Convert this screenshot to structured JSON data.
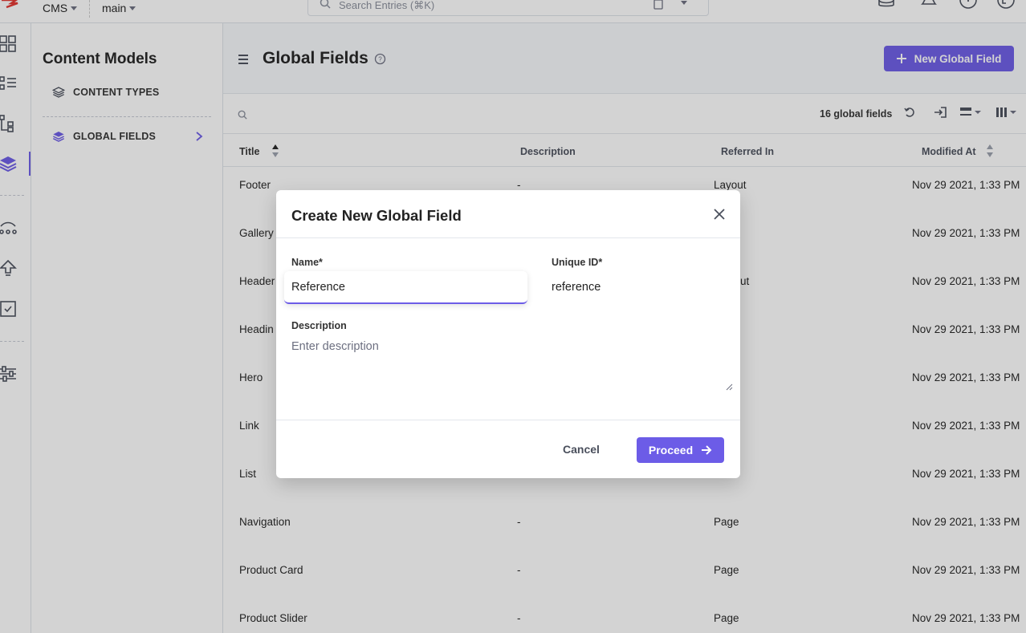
{
  "topbar": {
    "stack": "CMS",
    "branch": "main",
    "search_placeholder": "Search Entries (⌘K)"
  },
  "sidebar": {
    "title": "Content Models",
    "items": [
      {
        "label": "CONTENT TYPES"
      },
      {
        "label": "GLOBAL FIELDS"
      }
    ]
  },
  "main": {
    "title": "Global Fields",
    "new_button": "New Global Field",
    "count_label": "16 global fields",
    "columns": [
      "Title",
      "Description",
      "Referred In",
      "Modified At"
    ],
    "rows": [
      {
        "title": "Footer",
        "description": "-",
        "referred_in": "Layout",
        "modified": "Nov 29 2021, 1:33 PM"
      },
      {
        "title": "Gallery",
        "description": "",
        "referred_in": "",
        "modified": "Nov 29 2021, 1:33 PM"
      },
      {
        "title": "Header",
        "description": "",
        "referred_in": "ut",
        "modified": "Nov 29 2021, 1:33 PM"
      },
      {
        "title": "Headin",
        "description": "",
        "referred_in": "",
        "modified": "Nov 29 2021, 1:33 PM"
      },
      {
        "title": "Hero",
        "description": "",
        "referred_in": "",
        "modified": "Nov 29 2021, 1:33 PM"
      },
      {
        "title": "Link",
        "description": "",
        "referred_in": "",
        "modified": "Nov 29 2021, 1:33 PM"
      },
      {
        "title": "List",
        "description": "",
        "referred_in": "",
        "modified": "Nov 29 2021, 1:33 PM"
      },
      {
        "title": "Navigation",
        "description": "-",
        "referred_in": "Page",
        "modified": "Nov 29 2021, 1:33 PM"
      },
      {
        "title": "Product Card",
        "description": "-",
        "referred_in": "Page",
        "modified": "Nov 29 2021, 1:33 PM"
      },
      {
        "title": "Product Slider",
        "description": "-",
        "referred_in": "Page",
        "modified": "Nov 29 2021, 1:33 PM"
      }
    ]
  },
  "modal": {
    "title": "Create New Global Field",
    "name_label": "Name*",
    "name_value": "Reference",
    "uid_label": "Unique ID*",
    "uid_value": "reference",
    "description_label": "Description",
    "description_placeholder": "Enter description",
    "cancel_label": "Cancel",
    "proceed_label": "Proceed"
  },
  "colors": {
    "accent": "#6c5ce7",
    "overlay": "rgba(34,34,34,0.2)"
  }
}
